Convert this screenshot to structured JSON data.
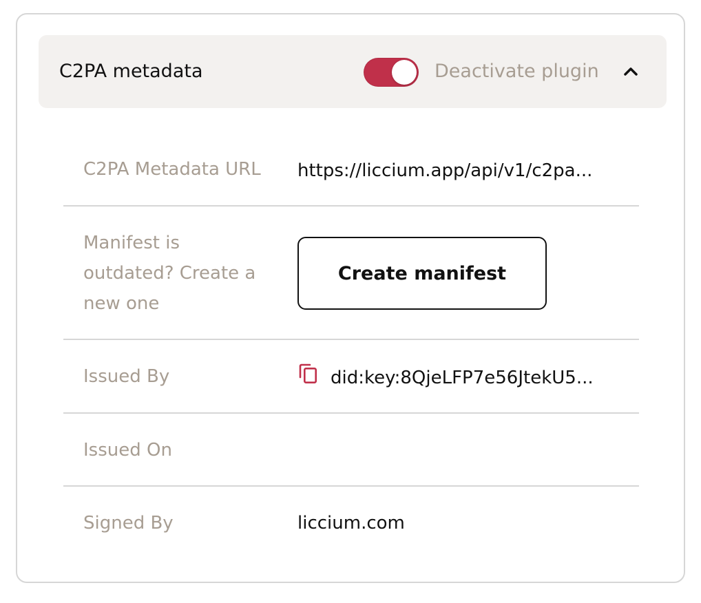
{
  "panel": {
    "title": "C2PA metadata",
    "toggle_label": "Deactivate plugin",
    "toggle_on": true,
    "accent_color": "#c0304a",
    "chevron_icon": "chevron-up-icon"
  },
  "rows": {
    "metadata_url": {
      "label": "C2PA Metadata URL",
      "value": "https://liccium.app/api/v1/c2pa..."
    },
    "manifest": {
      "label_line1": "Manifest is",
      "label_line2": "outdated? Create a",
      "label_line3": "new one",
      "button_label": "Create manifest"
    },
    "issued_by": {
      "label": "Issued By",
      "value": "did:key:8QjeLFP7e56JtekU5...",
      "icon": "copy-icon"
    },
    "issued_on": {
      "label": "Issued On",
      "value": ""
    },
    "signed_by": {
      "label": "Signed By",
      "value": "liccium.com"
    }
  }
}
